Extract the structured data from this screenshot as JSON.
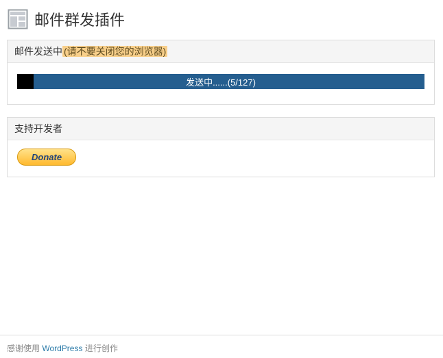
{
  "header": {
    "title": "邮件群发插件"
  },
  "sending_panel": {
    "status_prefix": "邮件发送中",
    "status_warning": "(请不要关闭您的浏览器)",
    "progress_label": "发送中......(5/127)",
    "progress_current": 5,
    "progress_total": 127,
    "progress_done_pct": "4%"
  },
  "support_panel": {
    "title": "支持开发者",
    "donate_label": "Donate"
  },
  "footer": {
    "prefix": "感谢使用 ",
    "link_text": "WordPress",
    "suffix": " 进行创作"
  }
}
